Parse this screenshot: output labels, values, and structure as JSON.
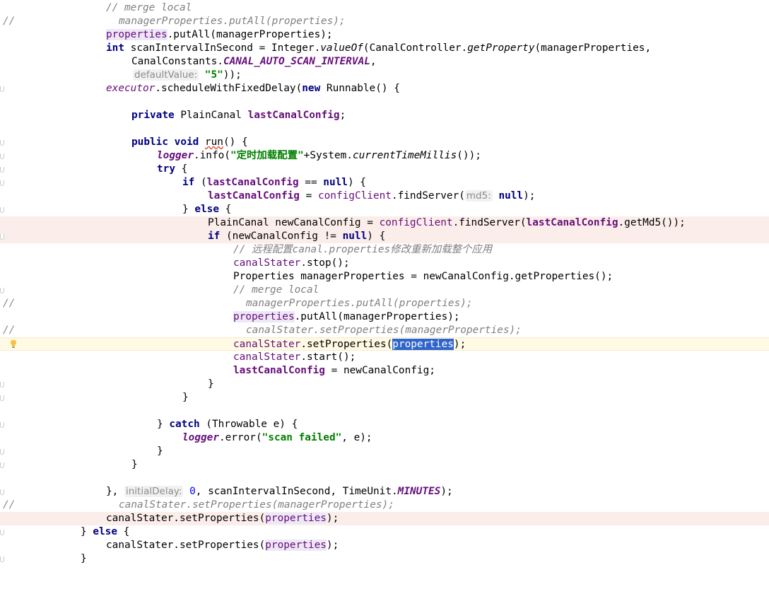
{
  "gutter": {
    "comment_marker": "//"
  },
  "hints": {
    "default_value": "defaultValue:",
    "md5": "md5:",
    "initial_delay": "initialDelay:"
  },
  "code": {
    "l1": "// merge local",
    "l2": "managerProperties.putAll(properties);",
    "l3_field": "properties",
    "l3_rest": ".putAll(managerProperties);",
    "l4_kw": "int",
    "l4_a": " scanIntervalInSecond = Integer.",
    "l4_static": "valueOf",
    "l4_b": "(CanalController.",
    "l4_static2": "getProperty",
    "l4_c": "(managerProperties,",
    "l5_a": "CanalConstants.",
    "l5_const": "CANAL_AUTO_SCAN_INTERVAL",
    "l5_b": ",",
    "l6_str": "\"5\"",
    "l6_b": "));",
    "l7_field": "executor",
    "l7_a": ".scheduleWithFixedDelay(",
    "l7_kw": "new",
    "l7_b": " Runnable() {",
    "l8_kw": "private",
    "l8_a": " PlainCanal ",
    "l8_field": "lastCanalConfig",
    "l8_b": ";",
    "l9_kw1": "public",
    "l9_kw2": "void",
    "l9_method": "run",
    "l9_b": "() {",
    "l10_field": "logger",
    "l10_a": ".info(",
    "l10_str": "\"定时加载配置\"",
    "l10_b": "+System.",
    "l10_static": "currentTimeMillis",
    "l10_c": "());",
    "l11_kw": "try",
    "l11_b": " {",
    "l12_kw": "if",
    "l12_a": " (",
    "l12_field": "lastCanalConfig",
    "l12_b": " == ",
    "l12_kw2": "null",
    "l12_c": ") {",
    "l13_field": "lastCanalConfig",
    "l13_a": " = ",
    "l13_field2": "configClient",
    "l13_b": ".findServer(",
    "l13_kw": "null",
    "l13_c": ");",
    "l14_a": "} ",
    "l14_kw": "else",
    "l14_b": " {",
    "l15_a": "PlainCanal newCanalConfig = ",
    "l15_field": "configClient",
    "l15_b": ".findServer(",
    "l15_field2": "lastCanalConfig",
    "l15_c": ".getMd5());",
    "l16_kw": "if",
    "l16_a": " (newCanalConfig != ",
    "l16_kw2": "null",
    "l16_b": ") {",
    "l17": "// 远程配置canal.properties修改重新加载整个应用",
    "l18_field": "canalStater",
    "l18_a": ".stop();",
    "l19": "Properties managerProperties = newCanalConfig.getProperties();",
    "l20": "// merge local",
    "l21": "managerProperties.putAll(properties);",
    "l22_field": "properties",
    "l22_a": ".putAll(managerProperties);",
    "l23": "canalStater.setProperties(managerProperties);",
    "l24_field": "canalStater",
    "l24_a": ".setProperties(",
    "l24_sel": "properties",
    "l24_b": ");",
    "l25_field": "canalStater",
    "l25_a": ".start();",
    "l26_field": "lastCanalConfig",
    "l26_a": " = newCanalConfig;",
    "l27": "}",
    "l28": "}",
    "l29_a": "} ",
    "l29_kw": "catch",
    "l29_b": " (Throwable e) {",
    "l30_field": "logger",
    "l30_a": ".error(",
    "l30_str": "\"scan failed\"",
    "l30_b": ", e);",
    "l31": "}",
    "l32": "}",
    "l33_a": "}, ",
    "l33_num": "0",
    "l33_b": ", scanIntervalInSecond, TimeUnit.",
    "l33_const": "MINUTES",
    "l33_c": ");",
    "l34": "canalStater.setProperties(managerProperties);",
    "l35_a": "canalStater.setProperties(",
    "l35_field": "properties",
    "l35_b": ");",
    "l36_a": "} ",
    "l36_kw": "else",
    "l36_b": " {",
    "l37_a": "canalStater.setProperties(",
    "l37_field": "properties",
    "l37_b": ");",
    "l38": "}"
  },
  "colors": {
    "keyword": "#000080",
    "field": "#660e7a",
    "string": "#008000",
    "comment": "#808080",
    "selection": "#2f65ca",
    "breakpoint_line": "#fbeeea",
    "caret_line": "#fffae3"
  },
  "icons": {
    "intention": "lightbulb-icon",
    "fold": "fold-marker-icon"
  }
}
